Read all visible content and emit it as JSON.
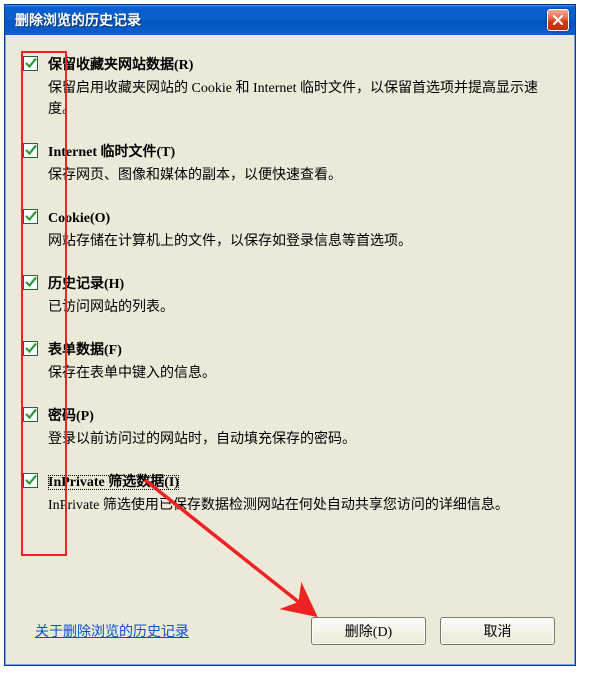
{
  "window": {
    "title": "删除浏览的历史记录"
  },
  "options": [
    {
      "label": "保留收藏夹网站数据(R)",
      "desc": "保留启用收藏夹网站的 Cookie 和 Internet 临时文件，以保留首选项并提高显示速度。",
      "checked": true
    },
    {
      "label": "Internet 临时文件(T)",
      "desc": "保存网页、图像和媒体的副本，以便快速查看。",
      "checked": true
    },
    {
      "label": "Cookie(O)",
      "desc": "网站存储在计算机上的文件，以保存如登录信息等首选项。",
      "checked": true
    },
    {
      "label": "历史记录(H)",
      "desc": "已访问网站的列表。",
      "checked": true
    },
    {
      "label": "表单数据(F)",
      "desc": "保存在表单中键入的信息。",
      "checked": true
    },
    {
      "label": "密码(P)",
      "desc": "登录以前访问过的网站时，自动填充保存的密码。",
      "checked": true
    },
    {
      "label": "InPrivate 筛选数据(I)",
      "desc": "InPrivate 筛选使用已保存数据检测网站在何处自动共享您访问的详细信息。",
      "checked": true,
      "focused": true
    }
  ],
  "footer": {
    "link": "关于删除浏览的历史记录",
    "delete": "删除(D)",
    "cancel": "取消"
  },
  "annotations": {
    "arrow_color": "#e22"
  }
}
